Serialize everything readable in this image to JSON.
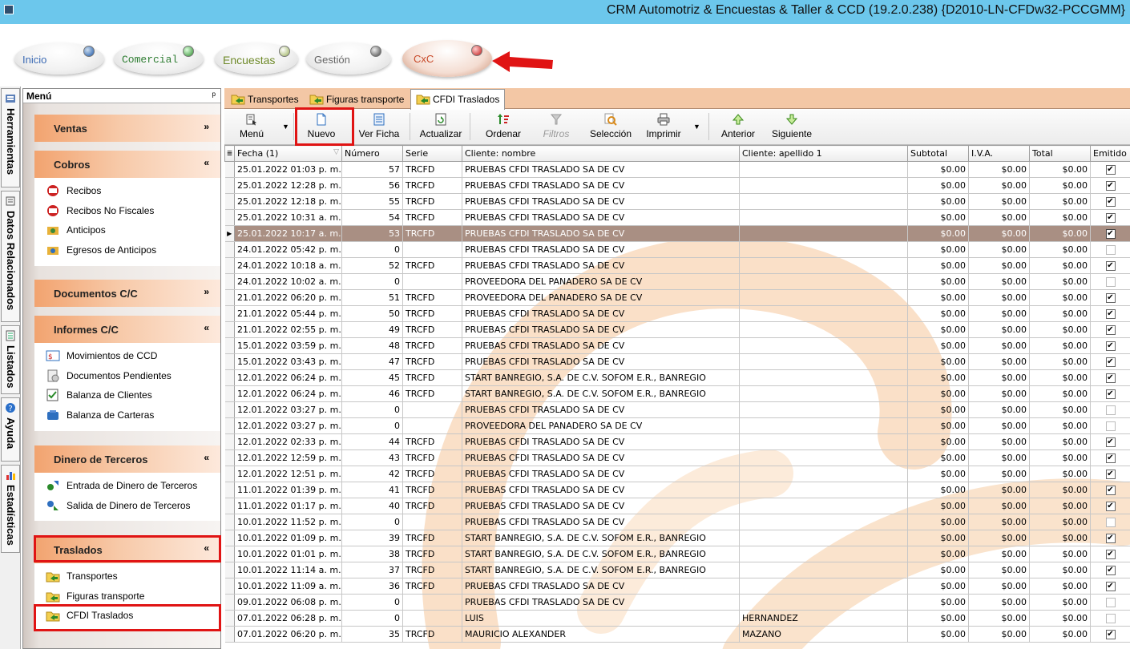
{
  "window": {
    "title": "CRM Automotriz & Encuestas & Taller & CCD (19.2.0.238) {D2010-LN-CFDw32-PCCGMM}"
  },
  "modules": [
    {
      "label": "Inicio"
    },
    {
      "label": "Comercial"
    },
    {
      "label": "Encuestas"
    },
    {
      "label": "Gestión"
    },
    {
      "label": "CxC"
    }
  ],
  "side_tabs": [
    {
      "label": "Herramientas"
    },
    {
      "label": "Datos Relacionados"
    },
    {
      "label": "Listados"
    },
    {
      "label": "Ayuda"
    },
    {
      "label": "Estadísticas"
    }
  ],
  "menu": {
    "title": "Menú",
    "pin": "ᵖ",
    "groups": {
      "ventas": {
        "title": "Ventas",
        "chevron": "»"
      },
      "cobros": {
        "title": "Cobros",
        "chevron": "«",
        "items": [
          "Recibos",
          "Recibos No Fiscales",
          "Anticipos",
          "Egresos de Anticipos"
        ]
      },
      "documentos": {
        "title": "Documentos C/C",
        "chevron": "»"
      },
      "informes": {
        "title": "Informes C/C",
        "chevron": "«",
        "items": [
          "Movimientos de CCD",
          "Documentos Pendientes",
          "Balanza de Clientes",
          "Balanza de Carteras"
        ]
      },
      "dinero": {
        "title": "Dinero de Terceros",
        "chevron": "«",
        "items": [
          "Entrada de Dinero de Terceros",
          "Salida de Dinero de Terceros"
        ]
      },
      "traslados": {
        "title": "Traslados",
        "chevron": "«",
        "items": [
          "Transportes",
          "Figuras transporte",
          "CFDI Traslados"
        ]
      }
    }
  },
  "tabs": [
    "Transportes",
    "Figuras transporte",
    "CFDI Traslados"
  ],
  "toolbar": {
    "menu": "Menú",
    "nuevo": "Nuevo",
    "ver_ficha": "Ver Ficha",
    "actualizar": "Actualizar",
    "ordenar": "Ordenar",
    "filtros": "Filtros",
    "seleccion": "Selección",
    "imprimir": "Imprimir",
    "anterior": "Anterior",
    "siguiente": "Siguiente"
  },
  "grid": {
    "columns": [
      "Fecha (1)",
      "Número",
      "Serie",
      "Cliente: nombre",
      "Cliente: apellido 1",
      "Subtotal",
      "I.V.A.",
      "Total",
      "Emitido"
    ],
    "selected_row": 4,
    "rows": [
      {
        "fecha": "25.01.2022 01:03 p. m.",
        "numero": "57",
        "serie": "TRCFD",
        "nombre": "PRUEBAS CFDI TRASLADO SA DE CV",
        "apellido": "",
        "subtotal": "$0.00",
        "iva": "$0.00",
        "total": "$0.00",
        "emitido": true
      },
      {
        "fecha": "25.01.2022 12:28 p. m.",
        "numero": "56",
        "serie": "TRCFD",
        "nombre": "PRUEBAS CFDI TRASLADO SA DE CV",
        "apellido": "",
        "subtotal": "$0.00",
        "iva": "$0.00",
        "total": "$0.00",
        "emitido": true
      },
      {
        "fecha": "25.01.2022 12:18 p. m.",
        "numero": "55",
        "serie": "TRCFD",
        "nombre": "PRUEBAS CFDI TRASLADO SA DE CV",
        "apellido": "",
        "subtotal": "$0.00",
        "iva": "$0.00",
        "total": "$0.00",
        "emitido": true
      },
      {
        "fecha": "25.01.2022 10:31 a. m.",
        "numero": "54",
        "serie": "TRCFD",
        "nombre": "PRUEBAS CFDI TRASLADO SA DE CV",
        "apellido": "",
        "subtotal": "$0.00",
        "iva": "$0.00",
        "total": "$0.00",
        "emitido": true
      },
      {
        "fecha": "25.01.2022 10:17 a. m.",
        "numero": "53",
        "serie": "TRCFD",
        "nombre": "PRUEBAS CFDI TRASLADO SA DE CV",
        "apellido": "",
        "subtotal": "$0.00",
        "iva": "$0.00",
        "total": "$0.00",
        "emitido": true
      },
      {
        "fecha": "24.01.2022 05:42 p. m.",
        "numero": "0",
        "serie": "",
        "nombre": "PRUEBAS CFDI TRASLADO SA DE CV",
        "apellido": "",
        "subtotal": "$0.00",
        "iva": "$0.00",
        "total": "$0.00",
        "emitido": false
      },
      {
        "fecha": "24.01.2022 10:18 a. m.",
        "numero": "52",
        "serie": "TRCFD",
        "nombre": "PRUEBAS CFDI TRASLADO SA DE CV",
        "apellido": "",
        "subtotal": "$0.00",
        "iva": "$0.00",
        "total": "$0.00",
        "emitido": true
      },
      {
        "fecha": "24.01.2022 10:02 a. m.",
        "numero": "0",
        "serie": "",
        "nombre": "PROVEEDORA DEL PANADERO SA DE CV",
        "apellido": "",
        "subtotal": "$0.00",
        "iva": "$0.00",
        "total": "$0.00",
        "emitido": false
      },
      {
        "fecha": "21.01.2022 06:20 p. m.",
        "numero": "51",
        "serie": "TRCFD",
        "nombre": "PROVEEDORA DEL PANADERO SA DE CV",
        "apellido": "",
        "subtotal": "$0.00",
        "iva": "$0.00",
        "total": "$0.00",
        "emitido": true
      },
      {
        "fecha": "21.01.2022 05:44 p. m.",
        "numero": "50",
        "serie": "TRCFD",
        "nombre": "PRUEBAS CFDI TRASLADO SA DE CV",
        "apellido": "",
        "subtotal": "$0.00",
        "iva": "$0.00",
        "total": "$0.00",
        "emitido": true
      },
      {
        "fecha": "21.01.2022 02:55 p. m.",
        "numero": "49",
        "serie": "TRCFD",
        "nombre": "PRUEBAS CFDI TRASLADO SA DE CV",
        "apellido": "",
        "subtotal": "$0.00",
        "iva": "$0.00",
        "total": "$0.00",
        "emitido": true
      },
      {
        "fecha": "15.01.2022 03:59 p. m.",
        "numero": "48",
        "serie": "TRCFD",
        "nombre": "PRUEBAS CFDI TRASLADO SA DE CV",
        "apellido": "",
        "subtotal": "$0.00",
        "iva": "$0.00",
        "total": "$0.00",
        "emitido": true
      },
      {
        "fecha": "15.01.2022 03:43 p. m.",
        "numero": "47",
        "serie": "TRCFD",
        "nombre": "PRUEBAS CFDI TRASLADO SA DE CV",
        "apellido": "",
        "subtotal": "$0.00",
        "iva": "$0.00",
        "total": "$0.00",
        "emitido": true
      },
      {
        "fecha": "12.01.2022 06:24 p. m.",
        "numero": "45",
        "serie": "TRCFD",
        "nombre": "START BANREGIO, S.A. DE C.V. SOFOM E.R., BANREGIO",
        "apellido": "",
        "subtotal": "$0.00",
        "iva": "$0.00",
        "total": "$0.00",
        "emitido": true
      },
      {
        "fecha": "12.01.2022 06:24 p. m.",
        "numero": "46",
        "serie": "TRCFD",
        "nombre": "START BANREGIO, S.A. DE C.V. SOFOM E.R., BANREGIO",
        "apellido": "",
        "subtotal": "$0.00",
        "iva": "$0.00",
        "total": "$0.00",
        "emitido": true
      },
      {
        "fecha": "12.01.2022 03:27 p. m.",
        "numero": "0",
        "serie": "",
        "nombre": "PRUEBAS CFDI TRASLADO SA DE CV",
        "apellido": "",
        "subtotal": "$0.00",
        "iva": "$0.00",
        "total": "$0.00",
        "emitido": false
      },
      {
        "fecha": "12.01.2022 03:27 p. m.",
        "numero": "0",
        "serie": "",
        "nombre": "PROVEEDORA DEL PANADERO SA DE CV",
        "apellido": "",
        "subtotal": "$0.00",
        "iva": "$0.00",
        "total": "$0.00",
        "emitido": false
      },
      {
        "fecha": "12.01.2022 02:33 p. m.",
        "numero": "44",
        "serie": "TRCFD",
        "nombre": "PRUEBAS CFDI TRASLADO SA DE CV",
        "apellido": "",
        "subtotal": "$0.00",
        "iva": "$0.00",
        "total": "$0.00",
        "emitido": true
      },
      {
        "fecha": "12.01.2022 12:59 p. m.",
        "numero": "43",
        "serie": "TRCFD",
        "nombre": "PRUEBAS CFDI TRASLADO SA DE CV",
        "apellido": "",
        "subtotal": "$0.00",
        "iva": "$0.00",
        "total": "$0.00",
        "emitido": true
      },
      {
        "fecha": "12.01.2022 12:51 p. m.",
        "numero": "42",
        "serie": "TRCFD",
        "nombre": "PRUEBAS CFDI TRASLADO SA DE CV",
        "apellido": "",
        "subtotal": "$0.00",
        "iva": "$0.00",
        "total": "$0.00",
        "emitido": true
      },
      {
        "fecha": "11.01.2022 01:39 p. m.",
        "numero": "41",
        "serie": "TRCFD",
        "nombre": "PRUEBAS CFDI TRASLADO SA DE CV",
        "apellido": "",
        "subtotal": "$0.00",
        "iva": "$0.00",
        "total": "$0.00",
        "emitido": true
      },
      {
        "fecha": "11.01.2022 01:17 p. m.",
        "numero": "40",
        "serie": "TRCFD",
        "nombre": "PRUEBAS CFDI TRASLADO SA DE CV",
        "apellido": "",
        "subtotal": "$0.00",
        "iva": "$0.00",
        "total": "$0.00",
        "emitido": true
      },
      {
        "fecha": "10.01.2022 11:52 p. m.",
        "numero": "0",
        "serie": "",
        "nombre": "PRUEBAS CFDI TRASLADO SA DE CV",
        "apellido": "",
        "subtotal": "$0.00",
        "iva": "$0.00",
        "total": "$0.00",
        "emitido": false
      },
      {
        "fecha": "10.01.2022 01:09 p. m.",
        "numero": "39",
        "serie": "TRCFD",
        "nombre": "START BANREGIO, S.A. DE C.V. SOFOM E.R., BANREGIO",
        "apellido": "",
        "subtotal": "$0.00",
        "iva": "$0.00",
        "total": "$0.00",
        "emitido": true
      },
      {
        "fecha": "10.01.2022 01:01 p. m.",
        "numero": "38",
        "serie": "TRCFD",
        "nombre": "START BANREGIO, S.A. DE C.V. SOFOM E.R., BANREGIO",
        "apellido": "",
        "subtotal": "$0.00",
        "iva": "$0.00",
        "total": "$0.00",
        "emitido": true
      },
      {
        "fecha": "10.01.2022 11:14 a. m.",
        "numero": "37",
        "serie": "TRCFD",
        "nombre": "START BANREGIO, S.A. DE C.V. SOFOM E.R., BANREGIO",
        "apellido": "",
        "subtotal": "$0.00",
        "iva": "$0.00",
        "total": "$0.00",
        "emitido": true
      },
      {
        "fecha": "10.01.2022 11:09 a. m.",
        "numero": "36",
        "serie": "TRCFD",
        "nombre": "PRUEBAS CFDI TRASLADO SA DE CV",
        "apellido": "",
        "subtotal": "$0.00",
        "iva": "$0.00",
        "total": "$0.00",
        "emitido": true
      },
      {
        "fecha": "09.01.2022 06:08 p. m.",
        "numero": "0",
        "serie": "",
        "nombre": "PRUEBAS CFDI TRASLADO SA DE CV",
        "apellido": "",
        "subtotal": "$0.00",
        "iva": "$0.00",
        "total": "$0.00",
        "emitido": false
      },
      {
        "fecha": "07.01.2022 06:28 p. m.",
        "numero": "0",
        "serie": "",
        "nombre": "LUIS",
        "apellido": "HERNANDEZ",
        "subtotal": "$0.00",
        "iva": "$0.00",
        "total": "$0.00",
        "emitido": false
      },
      {
        "fecha": "07.01.2022 06:20 p. m.",
        "numero": "35",
        "serie": "TRCFD",
        "nombre": "MAURICIO ALEXANDER",
        "apellido": "MAZANO",
        "subtotal": "$0.00",
        "iva": "$0.00",
        "total": "$0.00",
        "emitido": true
      }
    ]
  },
  "colors": {
    "titlebar": "#6cc7ec",
    "accent_orange": "#f3c7a5",
    "selected_row": "#a98f83",
    "annotation_red": "#e01414"
  }
}
